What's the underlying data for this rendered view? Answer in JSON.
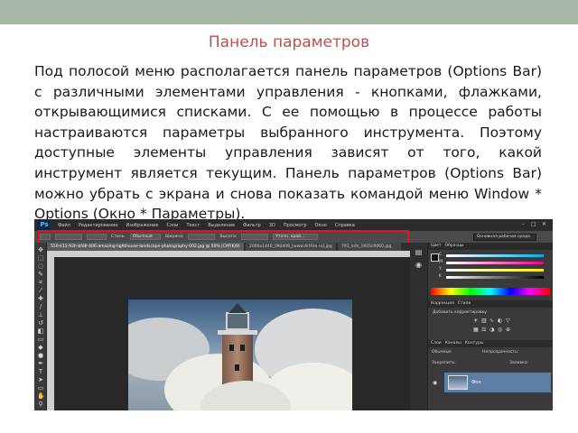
{
  "slide": {
    "title": "Панель параметров",
    "paragraph": "Под полосой меню располагается панель параметров (Options Bar) с различными элементами управления - кнопками, флажками, открывающимися списками. С ее помощью в процессе работы настраиваются параметры выбранного инструмента. Поэтому доступные элементы управления зависят от того, какой инструмент является текущим. Панель параметров (Options Bar) можно убрать с экрана и снова показать командой меню Window * Options (Окно * Параметры)."
  },
  "photoshop": {
    "logo": "Ps",
    "menu": [
      "Файл",
      "Редактирование",
      "Изображение",
      "Слои",
      "Текст",
      "Выделение",
      "Фильтр",
      "3D",
      "Просмотр",
      "Окно",
      "Справка"
    ],
    "window_controls": [
      "–",
      "□",
      "✕"
    ],
    "options_bar": {
      "labels": [
        "Стиль:",
        "Обычный",
        "Ширина:",
        "Высота:",
        "Уточн. край..."
      ],
      "workspace": "Основная рабочая среда"
    },
    "doc_tabs": [
      {
        "label": "550-k15-93h-bfd6-406-amazing-lighthouse-landscape-photography-002.jpg @ 50% (CMYK/8)",
        "active": true
      },
      {
        "label": "2000x1440_090408_[www.ArtFile.ru].jpg",
        "active": false
      },
      {
        "label": "791_info_1605c0060.jpg",
        "active": false
      }
    ],
    "panels": {
      "color_tabs": [
        "Цвет",
        "Образцы"
      ],
      "color_sliders": [
        "C",
        "M",
        "Y",
        "K"
      ],
      "adjust_tabs": [
        "Коррекция",
        "Стили"
      ],
      "adjust_title": "Добавить корректировку",
      "layers_tabs": [
        "Слои",
        "Каналы",
        "Контуры"
      ],
      "blend_mode": "Обычные",
      "opacity_label": "Непрозрачность:",
      "lock_label": "Закрепить:",
      "fill_label": "Заливка:",
      "layer_name": "Фон"
    },
    "tool_icons": [
      "move-icon",
      "marquee-icon",
      "lasso-icon",
      "quick-select-icon",
      "crop-icon",
      "eyedropper-icon",
      "healing-icon",
      "brush-icon",
      "clone-icon",
      "history-brush-icon",
      "eraser-icon",
      "gradient-icon",
      "blur-icon",
      "dodge-icon",
      "pen-icon",
      "type-icon",
      "path-select-icon",
      "shape-icon",
      "hand-icon",
      "zoom-icon"
    ],
    "colors": {
      "highlight": "#e0141a",
      "title": "#c0504d"
    }
  }
}
